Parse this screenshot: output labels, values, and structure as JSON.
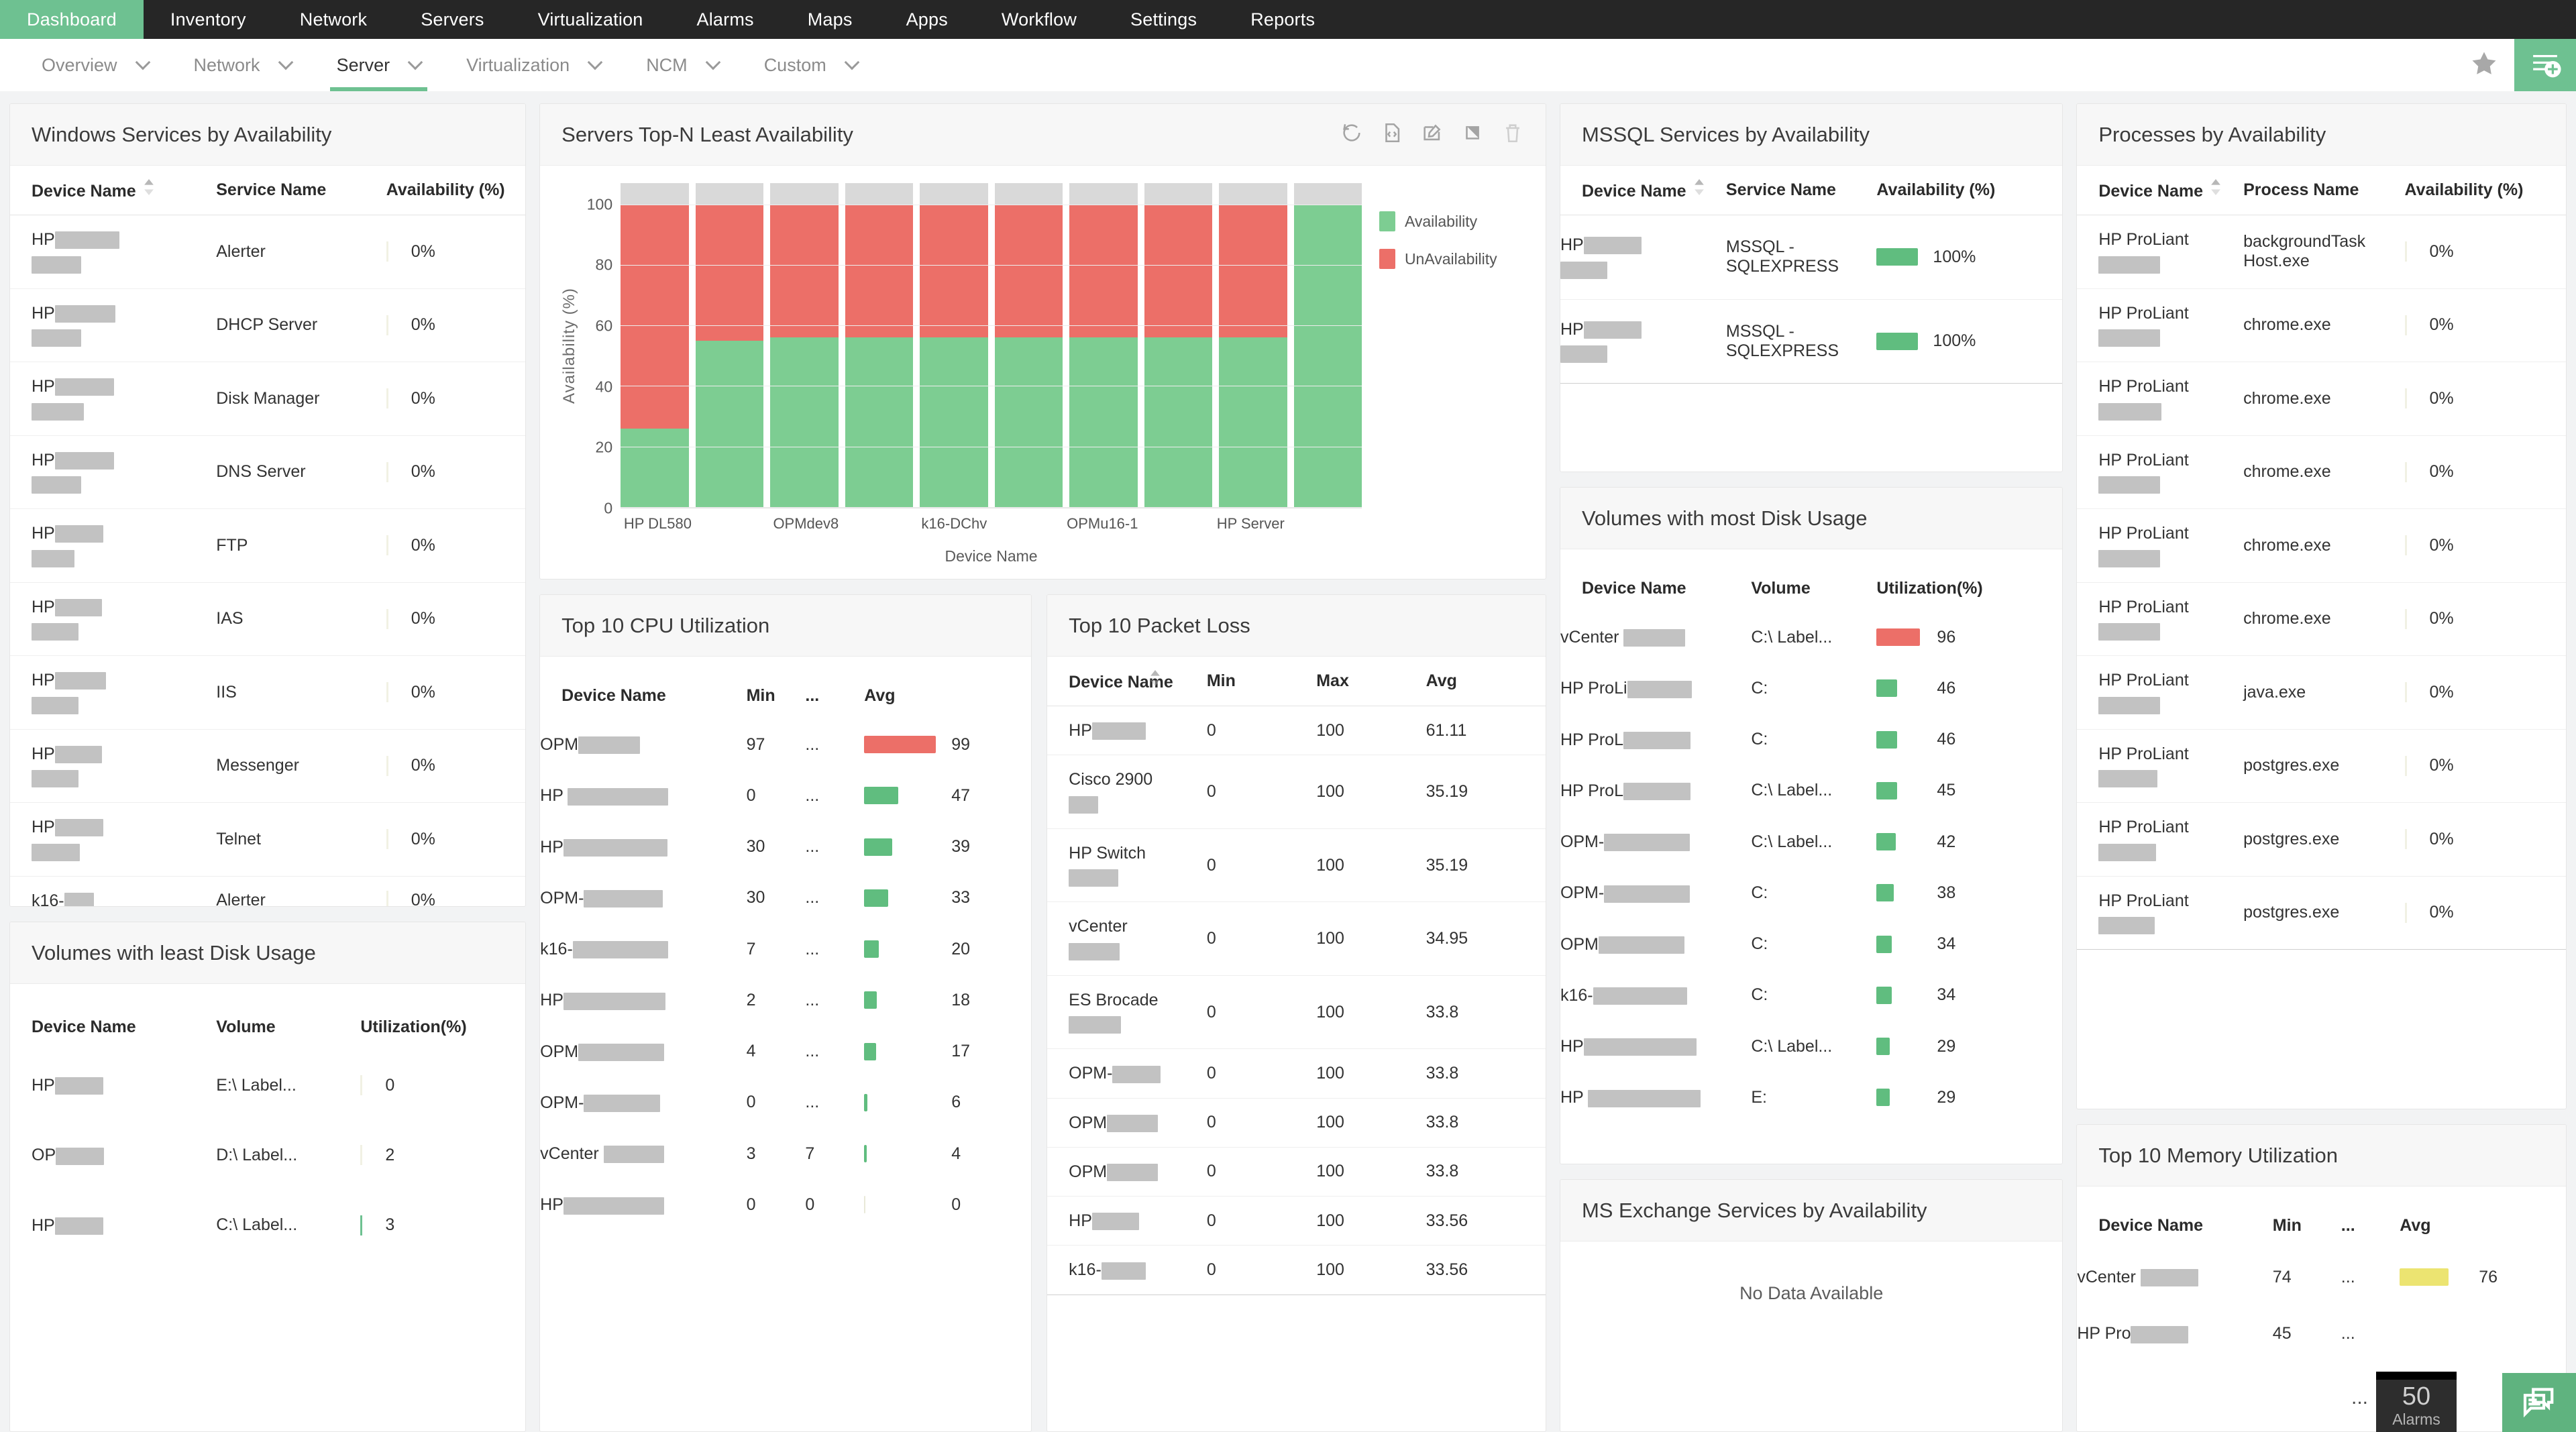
{
  "topnav": {
    "items": [
      {
        "label": "Dashboard",
        "active": true
      },
      {
        "label": "Inventory",
        "active": false
      },
      {
        "label": "Network",
        "active": false
      },
      {
        "label": "Servers",
        "active": false
      },
      {
        "label": "Virtualization",
        "active": false
      },
      {
        "label": "Alarms",
        "active": false
      },
      {
        "label": "Maps",
        "active": false
      },
      {
        "label": "Apps",
        "active": false
      },
      {
        "label": "Workflow",
        "active": false
      },
      {
        "label": "Settings",
        "active": false
      },
      {
        "label": "Reports",
        "active": false
      }
    ]
  },
  "subnav": {
    "items": [
      {
        "label": "Overview",
        "active": false
      },
      {
        "label": "Network",
        "active": false
      },
      {
        "label": "Server",
        "active": true
      },
      {
        "label": "Virtualization",
        "active": false
      },
      {
        "label": "NCM",
        "active": false
      },
      {
        "label": "Custom",
        "active": false
      }
    ],
    "favorite_icon": "star-icon",
    "add_widget_icon": "add-widget-icon"
  },
  "widgets": {
    "windows_services": {
      "title": "Windows Services by Availability",
      "columns": [
        "Device Name",
        "Service Name",
        "Availability (%)"
      ],
      "rows": [
        {
          "device_prefix": "HP",
          "redact_w1": 96,
          "redact_w2": 74,
          "service": "Alerter",
          "availability": "0%",
          "tick": "faint"
        },
        {
          "device_prefix": "HP",
          "redact_w1": 90,
          "redact_w2": 74,
          "service": "DHCP Server",
          "availability": "0%",
          "tick": "faint"
        },
        {
          "device_prefix": "HP",
          "redact_w1": 88,
          "redact_w2": 78,
          "service": "Disk Manager",
          "availability": "0%",
          "tick": "faint"
        },
        {
          "device_prefix": "HP",
          "redact_w1": 88,
          "redact_w2": 74,
          "service": "DNS Server",
          "availability": "0%",
          "tick": "faint"
        },
        {
          "device_prefix": "HP",
          "redact_w1": 72,
          "redact_w2": 64,
          "service": "FTP",
          "availability": "0%",
          "tick": "faint"
        },
        {
          "device_prefix": "HP",
          "redact_w1": 70,
          "redact_w2": 70,
          "service": "IAS",
          "availability": "0%",
          "tick": "faint"
        },
        {
          "device_prefix": "HP",
          "redact_w1": 76,
          "redact_w2": 70,
          "service": "IIS",
          "availability": "0%",
          "tick": "faint"
        },
        {
          "device_prefix": "HP",
          "redact_w1": 70,
          "redact_w2": 70,
          "service": "Messenger",
          "availability": "0%",
          "tick": "faint"
        },
        {
          "device_prefix": "HP",
          "redact_w1": 72,
          "redact_w2": 72,
          "service": "Telnet",
          "availability": "0%",
          "tick": "faint"
        },
        {
          "device_prefix": "k16-",
          "redact_w1": 44,
          "redact_w2": 0,
          "service": "Alerter",
          "availability": "0%",
          "tick": "faint"
        }
      ]
    },
    "volumes_least": {
      "title": "Volumes with least Disk Usage",
      "columns": [
        "Device Name",
        "Volume",
        "Utilization(%)"
      ],
      "rows": [
        {
          "device_prefix": "HP",
          "redact_w1": 72,
          "volume": "E:\\ Label...",
          "value": "0",
          "bar_pct": 0,
          "color": "#e9e9d8",
          "tick": "faint"
        },
        {
          "device_prefix": "OP",
          "redact_w1": 72,
          "volume": "D:\\ Label...",
          "value": "2",
          "bar_pct": 2,
          "color": "#e9e9d8",
          "tick": "faint"
        },
        {
          "device_prefix": "HP",
          "redact_w1": 72,
          "volume": "C:\\ Label...",
          "value": "3",
          "bar_pct": 3,
          "color": "#6ec191",
          "tick": "g"
        }
      ]
    },
    "servers_topn": {
      "title": "Servers Top-N Least Availability",
      "tools": [
        "refresh-icon",
        "embed-code-icon",
        "edit-icon",
        "resize-icon",
        "delete-icon"
      ]
    },
    "cpu_top10": {
      "title": "Top 10 CPU Utilization",
      "columns": [
        "Device Name",
        "Min",
        "...",
        "Avg"
      ],
      "rows": [
        {
          "device_prefix": "OPM",
          "redact_w1": 92,
          "min": "97",
          "mid": "...",
          "avg": "99",
          "bar_pct": 99,
          "color": "#ec6f68"
        },
        {
          "device_prefix": "HP ",
          "redact_w1": 150,
          "min": "0",
          "mid": "...",
          "avg": "47",
          "bar_pct": 47,
          "color": "#60bd7f"
        },
        {
          "device_prefix": "HP",
          "redact_w1": 155,
          "min": "30",
          "mid": "...",
          "avg": "39",
          "bar_pct": 39,
          "color": "#60bd7f"
        },
        {
          "device_prefix": "OPM-",
          "redact_w1": 118,
          "min": "30",
          "mid": "...",
          "avg": "33",
          "bar_pct": 33,
          "color": "#60bd7f"
        },
        {
          "device_prefix": "k16-",
          "redact_w1": 142,
          "min": "7",
          "mid": "...",
          "avg": "20",
          "bar_pct": 20,
          "color": "#60bd7f"
        },
        {
          "device_prefix": "HP",
          "redact_w1": 152,
          "min": "2",
          "mid": "...",
          "avg": "18",
          "bar_pct": 18,
          "color": "#60bd7f"
        },
        {
          "device_prefix": "OPM",
          "redact_w1": 128,
          "min": "4",
          "mid": "...",
          "avg": "17",
          "bar_pct": 17,
          "color": "#60bd7f"
        },
        {
          "device_prefix": "OPM-",
          "redact_w1": 114,
          "min": "0",
          "mid": "...",
          "avg": "6",
          "bar_pct": 5,
          "color": "#60bd7f"
        },
        {
          "device_prefix": "vCenter ",
          "redact_w1": 90,
          "min": "3",
          "mid": "7",
          "avg": "4",
          "bar_pct": 4,
          "color": "#60bd7f"
        },
        {
          "device_prefix": "HP",
          "redact_w1": 150,
          "min": "0",
          "mid": "0",
          "avg": "0",
          "bar_pct": 0,
          "color": "#e9e9d8"
        }
      ]
    },
    "packet_loss": {
      "title": "Top 10 Packet Loss",
      "columns": [
        "Device Name",
        "Min",
        "Max",
        "Avg"
      ],
      "rows": [
        {
          "device_prefix": "HP",
          "redact_w1": 80,
          "redact_w2": 0,
          "min": "0",
          "max": "100",
          "avg": "61.11"
        },
        {
          "device_prefix": "Cisco 2900",
          "redact_w1": 0,
          "redact_w2": 44,
          "min": "0",
          "max": "100",
          "avg": "35.19"
        },
        {
          "device_prefix": "HP Switch",
          "redact_w1": 0,
          "redact_w2": 74,
          "min": "0",
          "max": "100",
          "avg": "35.19"
        },
        {
          "device_prefix": "vCenter",
          "redact_w1": 0,
          "redact_w2": 76,
          "min": "0",
          "max": "100",
          "avg": "34.95"
        },
        {
          "device_prefix": "ES Brocade",
          "redact_w1": 0,
          "redact_w2": 78,
          "min": "0",
          "max": "100",
          "avg": "33.8"
        },
        {
          "device_prefix": "OPM-",
          "redact_w1": 72,
          "redact_w2": 0,
          "min": "0",
          "max": "100",
          "avg": "33.8"
        },
        {
          "device_prefix": "OPM",
          "redact_w1": 76,
          "redact_w2": 0,
          "min": "0",
          "max": "100",
          "avg": "33.8"
        },
        {
          "device_prefix": "OPM",
          "redact_w1": 76,
          "redact_w2": 0,
          "min": "0",
          "max": "100",
          "avg": "33.8"
        },
        {
          "device_prefix": "HP",
          "redact_w1": 70,
          "redact_w2": 0,
          "min": "0",
          "max": "100",
          "avg": "33.56"
        },
        {
          "device_prefix": "k16-",
          "redact_w1": 66,
          "redact_w2": 0,
          "min": "0",
          "max": "100",
          "avg": "33.56"
        }
      ]
    },
    "mssql": {
      "title": "MSSQL Services by Availability",
      "columns": [
        "Device Name",
        "Service Name",
        "Availability (%)"
      ],
      "rows": [
        {
          "device_prefix": "HP",
          "redact_w1": 86,
          "redact_w2": 70,
          "service": "MSSQL - SQLEXPRESS",
          "availability": "100%",
          "bar_pct": 100,
          "color": "#60bd7f"
        },
        {
          "device_prefix": "HP",
          "redact_w1": 86,
          "redact_w2": 70,
          "service": "MSSQL - SQLEXPRESS",
          "availability": "100%",
          "bar_pct": 100,
          "color": "#60bd7f"
        }
      ]
    },
    "volumes_most": {
      "title": "Volumes with most Disk Usage",
      "columns": [
        "Device Name",
        "Volume",
        "Utilization(%)"
      ],
      "rows": [
        {
          "device_prefix": "vCenter ",
          "redact_w1": 92,
          "volume": "C:\\ Label...",
          "value": "96",
          "bar_pct": 96,
          "color": "#ec6f68"
        },
        {
          "device_prefix": "HP ProLi",
          "redact_w1": 96,
          "volume": "C:",
          "value": "46",
          "bar_pct": 46,
          "color": "#60bd7f"
        },
        {
          "device_prefix": "HP ProL",
          "redact_w1": 100,
          "volume": "C:",
          "value": "46",
          "bar_pct": 46,
          "color": "#60bd7f"
        },
        {
          "device_prefix": "HP ProL",
          "redact_w1": 100,
          "volume": "C:\\ Label...",
          "value": "45",
          "bar_pct": 45,
          "color": "#60bd7f"
        },
        {
          "device_prefix": "OPM-",
          "redact_w1": 128,
          "volume": "C:\\ Label...",
          "value": "42",
          "bar_pct": 42,
          "color": "#60bd7f"
        },
        {
          "device_prefix": "OPM-",
          "redact_w1": 128,
          "volume": "C:",
          "value": "38",
          "bar_pct": 38,
          "color": "#60bd7f"
        },
        {
          "device_prefix": "OPM",
          "redact_w1": 128,
          "volume": "C:",
          "value": "34",
          "bar_pct": 34,
          "color": "#60bd7f"
        },
        {
          "device_prefix": "k16-",
          "redact_w1": 140,
          "volume": "C:",
          "value": "34",
          "bar_pct": 34,
          "color": "#60bd7f"
        },
        {
          "device_prefix": "HP",
          "redact_w1": 168,
          "volume": "C:\\ Label...",
          "value": "29",
          "bar_pct": 29,
          "color": "#60bd7f"
        },
        {
          "device_prefix": "HP ",
          "redact_w1": 168,
          "volume": "E:",
          "value": "29",
          "bar_pct": 29,
          "color": "#60bd7f"
        }
      ]
    },
    "ms_exchange": {
      "title": "MS Exchange Services by Availability",
      "empty_text": "No Data Available"
    },
    "processes": {
      "title": "Processes by Availability",
      "columns": [
        "Device Name",
        "Process Name",
        "Availability (%)"
      ],
      "rows": [
        {
          "device_prefix": "HP ProLiant",
          "redact_w2": 92,
          "process": "backgroundTask Host.exe",
          "availability": "0%"
        },
        {
          "device_prefix": "HP ProLiant",
          "redact_w2": 92,
          "process": "chrome.exe",
          "availability": "0%"
        },
        {
          "device_prefix": "HP ProLiant",
          "redact_w2": 94,
          "process": "chrome.exe",
          "availability": "0%"
        },
        {
          "device_prefix": "HP ProLiant",
          "redact_w2": 92,
          "process": "chrome.exe",
          "availability": "0%"
        },
        {
          "device_prefix": "HP ProLiant",
          "redact_w2": 92,
          "process": "chrome.exe",
          "availability": "0%"
        },
        {
          "device_prefix": "HP ProLiant",
          "redact_w2": 92,
          "process": "chrome.exe",
          "availability": "0%"
        },
        {
          "device_prefix": "HP ProLiant",
          "redact_w2": 92,
          "process": "java.exe",
          "availability": "0%"
        },
        {
          "device_prefix": "HP ProLiant",
          "redact_w2": 88,
          "process": "postgres.exe",
          "availability": "0%"
        },
        {
          "device_prefix": "HP ProLiant",
          "redact_w2": 86,
          "process": "postgres.exe",
          "availability": "0%"
        },
        {
          "device_prefix": "HP ProLiant",
          "redact_w2": 84,
          "process": "postgres.exe",
          "availability": "0%"
        }
      ]
    },
    "memory_top10": {
      "title": "Top 10 Memory Utilization",
      "columns": [
        "Device Name",
        "Min",
        "...",
        "Avg"
      ],
      "rows": [
        {
          "device_prefix": "vCenter ",
          "redact_w1": 86,
          "min": "74",
          "mid": "...",
          "avg": "76",
          "bar_pct": 76,
          "color": "#ece471"
        },
        {
          "device_prefix": "HP Pro",
          "redact_w1": 86,
          "min": "45",
          "mid": "...",
          "avg": "",
          "bar_pct": 0,
          "color": "#60bd7f"
        }
      ]
    }
  },
  "floating": {
    "alarms_count": "50",
    "alarms_label": "Alarms",
    "chat_icon": "chat-icon",
    "overflow_dots": "..."
  },
  "chart_data": {
    "type": "bar",
    "title": "Servers Top-N Least Availability",
    "xlabel": "Device Name",
    "ylabel": "Availability (%)",
    "ylim": [
      0,
      100
    ],
    "yticks": [
      0,
      20,
      40,
      60,
      80,
      100
    ],
    "grid": true,
    "stacked": true,
    "legend_position": "right",
    "legend": [
      "Availability",
      "UnAvailability"
    ],
    "colors": {
      "Availability": "#7dcd92",
      "UnAvailability": "#ec6f68",
      "remainder": "#d9d9d9"
    },
    "categories": [
      "HP DL580",
      "",
      "OPMdev8",
      "",
      "k16-DChv",
      "",
      "OPMu16-1",
      "",
      "HP Server",
      ""
    ],
    "tick_labels": [
      "HP DL580",
      "OPMdev8",
      "k16-DChv",
      "OPMu16-1",
      "HP Server"
    ],
    "series": [
      {
        "name": "Availability",
        "values": [
          26,
          55,
          56,
          56,
          56,
          56,
          56,
          56,
          56,
          100
        ]
      },
      {
        "name": "UnAvailability",
        "values": [
          74,
          45,
          44,
          44,
          44,
          44,
          44,
          44,
          44,
          0
        ]
      }
    ]
  }
}
